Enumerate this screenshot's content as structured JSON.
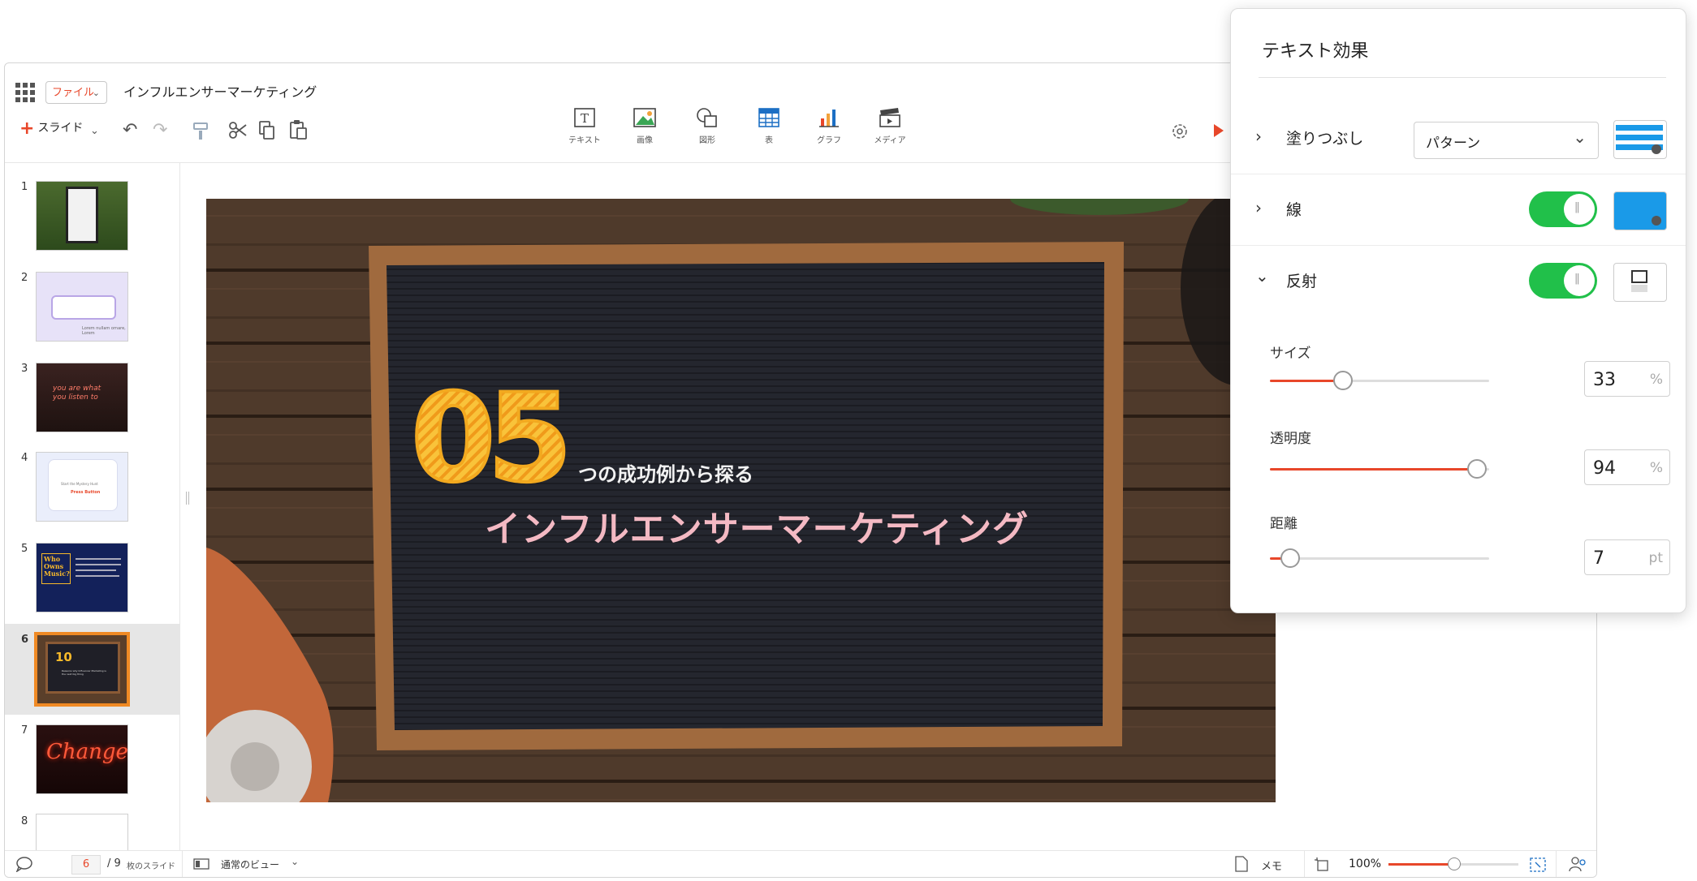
{
  "app": {
    "file_menu_label": "ファイル",
    "doc_title": "インフルエンサーマーケティング",
    "add_slide_label": "スライド"
  },
  "insert_toolbar": [
    {
      "label": "テキスト",
      "icon": "text-box-icon"
    },
    {
      "label": "画像",
      "icon": "image-icon"
    },
    {
      "label": "図形",
      "icon": "shape-icon"
    },
    {
      "label": "表",
      "icon": "table-icon"
    },
    {
      "label": "グラフ",
      "icon": "chart-icon"
    },
    {
      "label": "メディア",
      "icon": "media-icon"
    }
  ],
  "slides": [
    {
      "num": "1"
    },
    {
      "num": "2"
    },
    {
      "num": "3"
    },
    {
      "num": "4"
    },
    {
      "num": "5"
    },
    {
      "num": "6"
    },
    {
      "num": "7"
    },
    {
      "num": "8"
    }
  ],
  "thumb_text": {
    "s2_caption": "Lorem nullam ornare, Lorem",
    "s3_neon": "you are what you listen to",
    "s4_small": "Start the Mystery Hunt",
    "s4_button": "Press Button",
    "s5_title": "Who Owns Music?",
    "s6_number": "10",
    "s6_text": "Reasons why Influencer Marketing is the next big thing",
    "s7_neon": "Change"
  },
  "slide": {
    "big_number": "05",
    "subtitle": "つの成功例から探る",
    "title": "インフルエンサーマーケティング"
  },
  "status": {
    "current_slide": "6",
    "total_slides": "/ 9",
    "slides_suffix": "枚のスライド",
    "view_label": "通常のビュー",
    "notes_label": "メモ",
    "zoom": "100%",
    "zoom_fraction": 0.5
  },
  "effects_panel": {
    "title": "テキスト効果",
    "fill": {
      "label": "塗りつぶし",
      "select_value": "パターン"
    },
    "stroke": {
      "label": "線",
      "enabled": true
    },
    "reflection": {
      "label": "反射",
      "enabled": true,
      "size": {
        "label": "サイズ",
        "value": "33",
        "unit": "%",
        "fraction": 0.33
      },
      "transparency": {
        "label": "透明度",
        "value": "94",
        "unit": "%",
        "fraction": 0.94
      },
      "distance": {
        "label": "距離",
        "value": "7",
        "unit": "pt",
        "fraction": 0.07
      }
    }
  },
  "colors": {
    "accent": "#e8472a",
    "toggle_on": "#21c04a",
    "stroke_swatch": "#1a9ae8",
    "number_yellow": "#f7b92a",
    "title_pink": "#f4b9c3",
    "selected_thumb_border": "#f08a24"
  }
}
